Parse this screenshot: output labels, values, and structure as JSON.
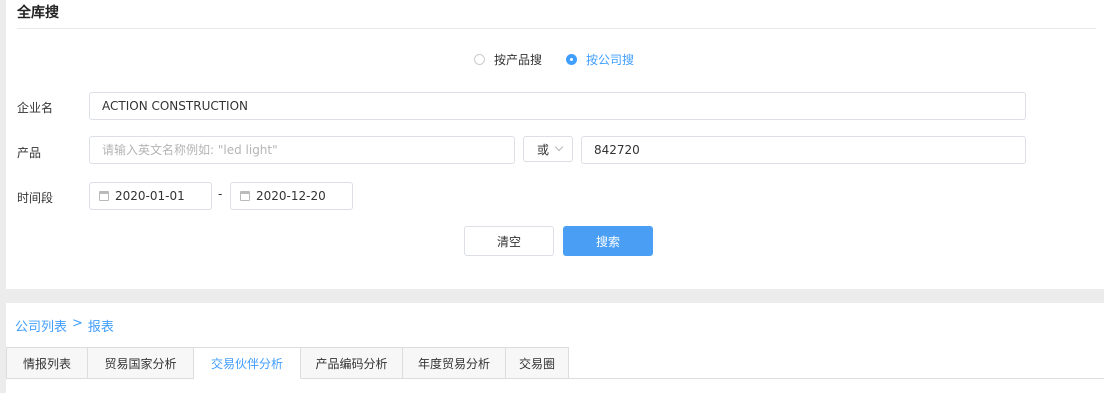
{
  "page": {
    "title": "全库搜"
  },
  "search_mode": {
    "options": [
      {
        "label": "按产品搜",
        "checked": false
      },
      {
        "label": "按公司搜",
        "checked": true
      }
    ]
  },
  "form": {
    "company": {
      "label": "企业名",
      "value": "ACTION CONSTRUCTION"
    },
    "product": {
      "label": "产品",
      "placeholder": "请输入英文名称例如: \"led light\"",
      "operator": "或",
      "code_value": "842720"
    },
    "period": {
      "label": "时间段",
      "start": "2020-01-01",
      "separator": "-",
      "end": "2020-12-20"
    }
  },
  "buttons": {
    "clear": "清空",
    "search": "搜索"
  },
  "breadcrumb": {
    "items": [
      "公司列表",
      "报表"
    ],
    "separator": ">"
  },
  "tabs": [
    {
      "label": "情报列表",
      "active": false
    },
    {
      "label": "贸易国家分析",
      "active": false
    },
    {
      "label": "交易伙伴分析",
      "active": true
    },
    {
      "label": "产品编码分析",
      "active": false
    },
    {
      "label": "年度贸易分析",
      "active": false
    },
    {
      "label": "交易圈",
      "active": false
    }
  ],
  "colors": {
    "accent": "#409eff",
    "button_primary": "#4a9ff5"
  }
}
